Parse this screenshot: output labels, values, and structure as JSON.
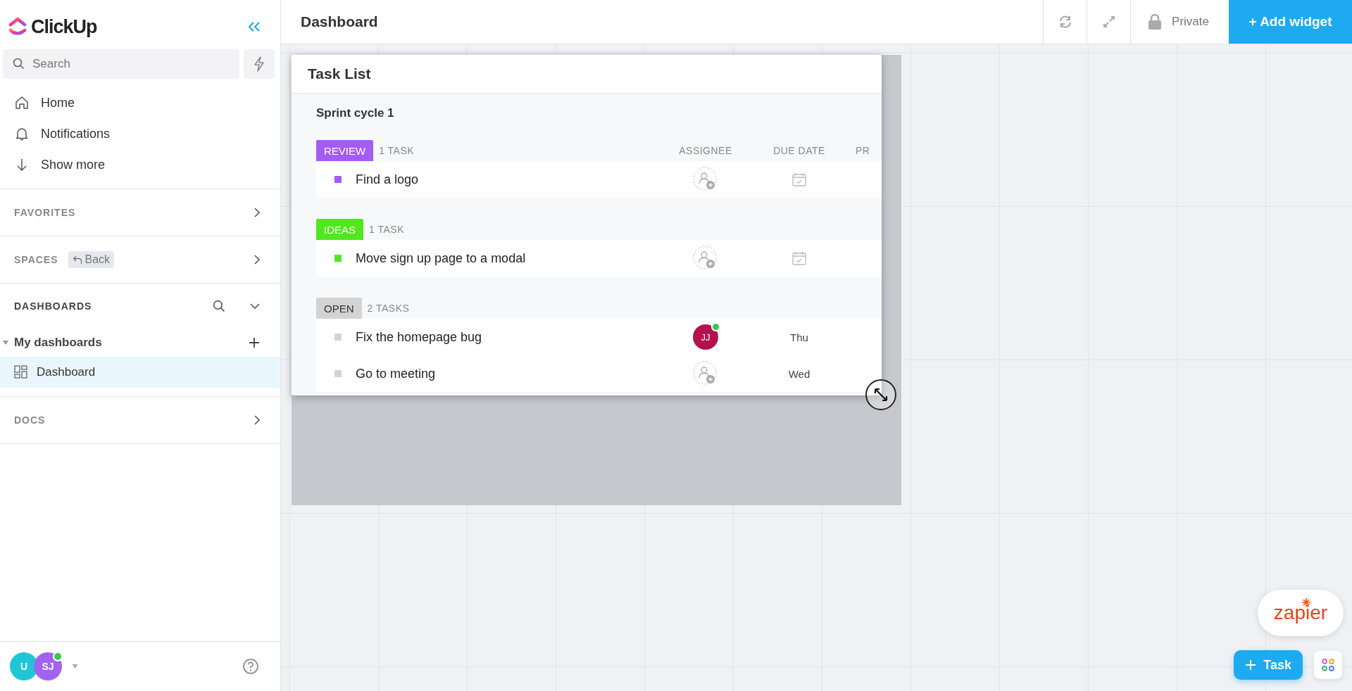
{
  "sidebar": {
    "logo": "ClickUp",
    "search": {
      "placeholder": "Search"
    },
    "nav": [
      {
        "kind": "home",
        "label": "Home"
      },
      {
        "kind": "bell",
        "label": "Notifications"
      },
      {
        "kind": "down",
        "label": "Show more"
      }
    ],
    "favorites": {
      "label": "FAVORITES"
    },
    "spaces": {
      "label": "SPACES",
      "back": "Back"
    },
    "dashboards": {
      "label": "DASHBOARDS",
      "expanded": true,
      "folders": [
        {
          "label": "My dashboards",
          "expanded": true,
          "children": [
            {
              "label": "Dashboard",
              "selected": true
            }
          ]
        }
      ]
    },
    "docs": {
      "label": "DOCS"
    },
    "avatars": [
      {
        "initials": "U",
        "color": "#21c6d6",
        "online": false
      },
      {
        "initials": "SJ",
        "color": "#a262f0",
        "online": true
      }
    ]
  },
  "topbar": {
    "title": "Dashboard",
    "privacy": "Private",
    "add_widget": "+ Add widget"
  },
  "widget": {
    "title": "Task List",
    "list_name": "Sprint cycle 1",
    "columns": [
      "ASSIGNEE",
      "DUE DATE",
      "PR"
    ],
    "groups": [
      {
        "status": "REVIEW",
        "color": "#a35cf5",
        "count": "1 TASK",
        "tasks": [
          {
            "name": "Find a logo"
          }
        ]
      },
      {
        "status": "IDEAS",
        "color": "#4ee81c",
        "count": "1 TASK",
        "tasks": [
          {
            "name": "Move sign up page to a modal"
          }
        ]
      },
      {
        "status": "OPEN",
        "color": "#d3d3d3",
        "count": "2 TASKS",
        "tasks": [
          {
            "name": "Fix the homepage bug",
            "assignee": {
              "initials": "JJ",
              "color": "#b3124f",
              "online": true
            },
            "due": "Thu"
          },
          {
            "name": "Go to meeting",
            "due": "Wed"
          }
        ]
      }
    ]
  },
  "floating": {
    "zapier": "zapier",
    "task_button": "Task"
  }
}
